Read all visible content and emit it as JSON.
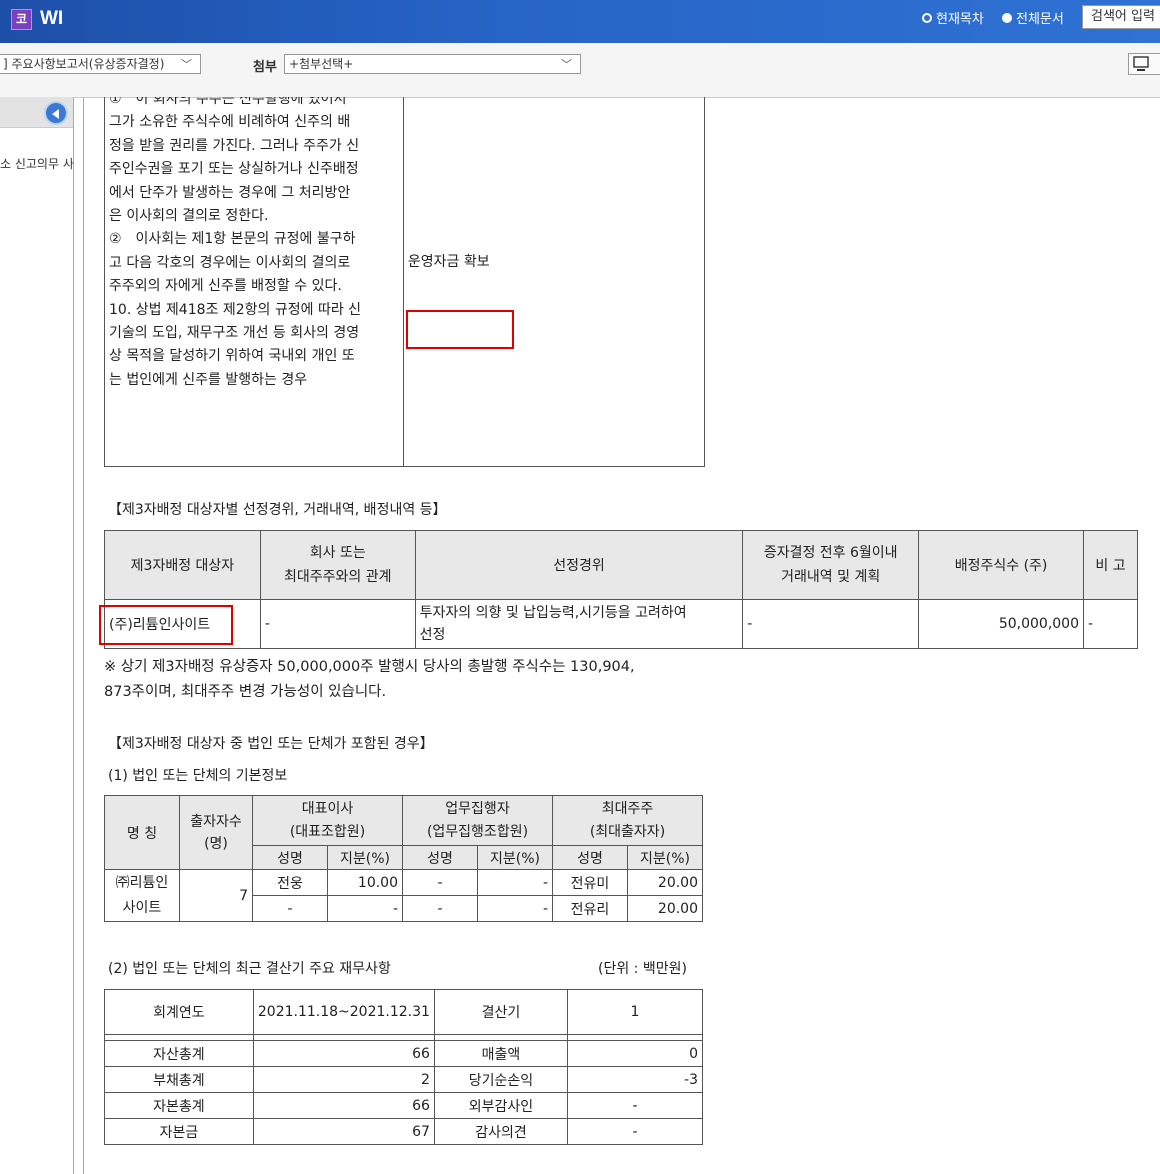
{
  "app": {
    "logo_char": "코",
    "title": "WI"
  },
  "search_scope": {
    "current": "현재목차",
    "all": "전체문서"
  },
  "search_button": "검색어 입력",
  "toolbar": {
    "document_select": "] 주요사항보고서(유상증자결정)",
    "attach_label": "첨부",
    "attach_select": "+첨부선택+"
  },
  "sidebar": {
    "item": "소 신고의무 사"
  },
  "articles_text": [
    "①　이 회사의 주주는 신주발행에 있어서",
    "그가 소유한 주식수에 비례하여 신주의 배",
    "정을 받을 권리를 가진다. 그러나 주주가 신",
    "주인수권을 포기 또는 상실하거나 신주배정",
    "에서 단주가 발생하는 경우에 그 처리방안",
    "은 이사회의 결의로 정한다.",
    "②　이사회는 제1항 본문의 규정에 불구하",
    "고 다음 각호의 경우에는 이사회의 결의로",
    "주주외의 자에게 신주를 배정할 수 있다.",
    "10. 상법 제418조 제2항의 규정에 따라 신",
    "기술의 도입, 재무구조 개선 등 회사의 경영",
    "상 목적을 달성하기 위하여 국내외 개인 또",
    "는 법인에게 신주를 발행하는 경우"
  ],
  "purpose": "운영자금 확보",
  "third_party_heading": "【제3자배정 대상자별 선정경위, 거래내역, 배정내역 등】",
  "allotment_table": {
    "headers": [
      "제3자배정 대상자",
      "회사 또는\n최대주주와의 관계",
      "선정경위",
      "증자결정 전후 6월이내\n거래내역 및 계획",
      "배정주식수 (주)",
      "비 고"
    ],
    "row": {
      "name": "(주)리튬인사이트",
      "relation": "-",
      "reason": "투자자의 의향 및 납입능력,시기등을 고려하여\n선정",
      "history": "-",
      "shares": "50,000,000",
      "note": "-"
    }
  },
  "notice_lines": [
    "※ 상기 제3자배정 유상증자 50,000,000주 발행시 당사의 총발행 주식수는 130,904,",
    "873주이며,  최대주주 변경 가능성이 있습니다."
  ],
  "corporate_heading": "【제3자배정 대상자 중 법인 또는 단체가 포함된 경우】",
  "basic_info_title": "(1) 법인 또는 단체의 기본정보",
  "basic_info_table": {
    "h_name": "명 칭",
    "h_investors": "출자자수\n(명)",
    "h_ceo": "대표이사\n(대표조합원)",
    "h_exec": "업무집행자\n(업무집행조합원)",
    "h_major": "최대주주\n(최대출자자)",
    "sub_name": "성명",
    "sub_share": "지분(%)",
    "entity_name": "㈜리튬인\n사이트",
    "investors": "7",
    "rows": [
      {
        "ceo_name": "전웅",
        "ceo_share": "10.00",
        "exec_name": "-",
        "exec_share": "-",
        "major_name": "전유미",
        "major_share": "20.00"
      },
      {
        "ceo_name": "-",
        "ceo_share": "-",
        "exec_name": "-",
        "exec_share": "-",
        "major_name": "전유리",
        "major_share": "20.00"
      }
    ]
  },
  "financial_title": "(2) 법인 또는 단체의 최근 결산기 주요 재무사항",
  "financial_unit": "(단위 : 백만원)",
  "financial_table": {
    "fiscal_label": "회계연도",
    "fiscal_value": "2021.11.18~2021.12.31",
    "period_label": "결산기",
    "period_value": "1",
    "rows": [
      {
        "l1": "자산총계",
        "v1": "66",
        "l2": "매출액",
        "v2": "0"
      },
      {
        "l1": "부채총계",
        "v1": "2",
        "l2": "당기순손익",
        "v2": "-3"
      },
      {
        "l1": "자본총계",
        "v1": "66",
        "l2": "외부감사인",
        "v2": "-"
      },
      {
        "l1": "자본금",
        "v1": "67",
        "l2": "감사의견",
        "v2": "-"
      }
    ]
  }
}
